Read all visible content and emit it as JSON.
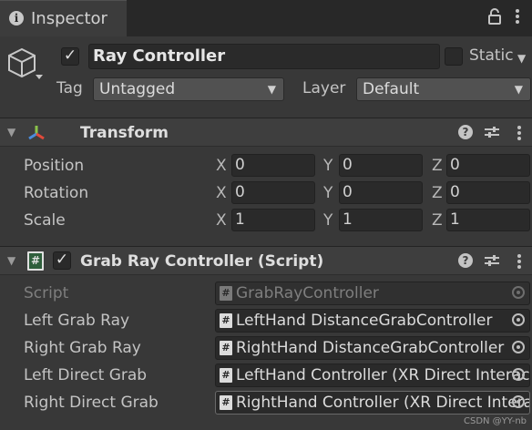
{
  "tab": {
    "label": "Inspector"
  },
  "header": {
    "name": "Ray Controller",
    "active_checked": "✓",
    "static_label": "Static",
    "tag_label": "Tag",
    "tag_value": "Untagged",
    "layer_label": "Layer",
    "layer_value": "Default"
  },
  "transform": {
    "title": "Transform",
    "rows": [
      {
        "label": "Position",
        "x": "0",
        "y": "0",
        "z": "0"
      },
      {
        "label": "Rotation",
        "x": "0",
        "y": "0",
        "z": "0"
      },
      {
        "label": "Scale",
        "x": "1",
        "y": "1",
        "z": "1"
      }
    ],
    "axes": {
      "x": "X",
      "y": "Y",
      "z": "Z"
    }
  },
  "component": {
    "title": "Grab Ray Controller (Script)",
    "enabled_checked": "✓",
    "rows": [
      {
        "label": "Script",
        "value": "GrabRayController"
      },
      {
        "label": "Left Grab Ray",
        "value": "LeftHand DistanceGrabController"
      },
      {
        "label": "Right Grab Ray",
        "value": "RightHand DistanceGrabController"
      },
      {
        "label": "Left Direct Grab",
        "value": "LeftHand Controller (XR Direct Interactor)"
      },
      {
        "label": "Right Direct Grab",
        "value": "RightHand Controller (XR Direct Interactor)"
      }
    ]
  },
  "watermark": "CSDN @YY-nb"
}
